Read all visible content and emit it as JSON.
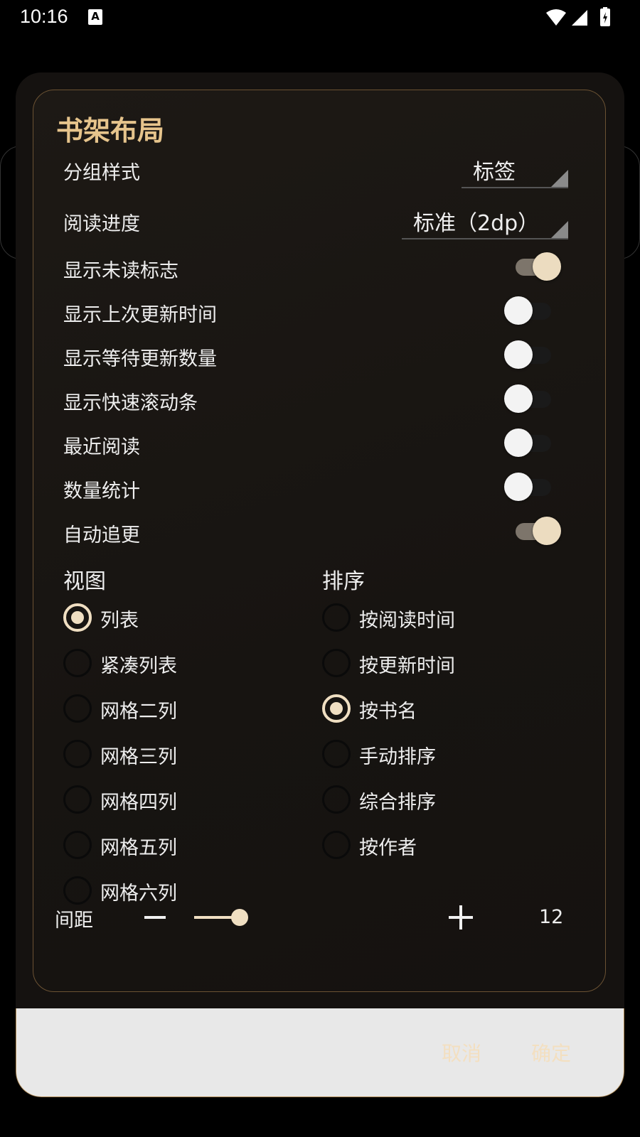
{
  "status_bar": {
    "time": "10:16",
    "notif_icon": "A"
  },
  "dialog": {
    "title": "书架布局",
    "group_style": {
      "label": "分组样式",
      "value": "标签"
    },
    "read_progress": {
      "label": "阅读进度",
      "value": "标准（2dp）"
    },
    "toggles": [
      {
        "label": "显示未读标志",
        "on": true
      },
      {
        "label": "显示上次更新时间",
        "on": false
      },
      {
        "label": "显示等待更新数量",
        "on": false
      },
      {
        "label": "显示快速滚动条",
        "on": false
      },
      {
        "label": "最近阅读",
        "on": false
      },
      {
        "label": "数量统计",
        "on": false
      },
      {
        "label": "自动追更",
        "on": true
      }
    ],
    "view": {
      "heading": "视图",
      "options": [
        "列表",
        "紧凑列表",
        "网格二列",
        "网格三列",
        "网格四列",
        "网格五列",
        "网格六列"
      ],
      "selected": "列表"
    },
    "sort": {
      "heading": "排序",
      "options": [
        "按阅读时间",
        "按更新时间",
        "按书名",
        "手动排序",
        "综合排序",
        "按作者"
      ],
      "selected": "按书名"
    },
    "spacing": {
      "label": "间距",
      "value": "12"
    },
    "buttons": {
      "cancel": "取消",
      "ok": "确定"
    }
  },
  "colors": {
    "accent": "#e6c48c",
    "switch_on_thumb": "#ecdcc0",
    "panel_border": "#6b5233"
  }
}
